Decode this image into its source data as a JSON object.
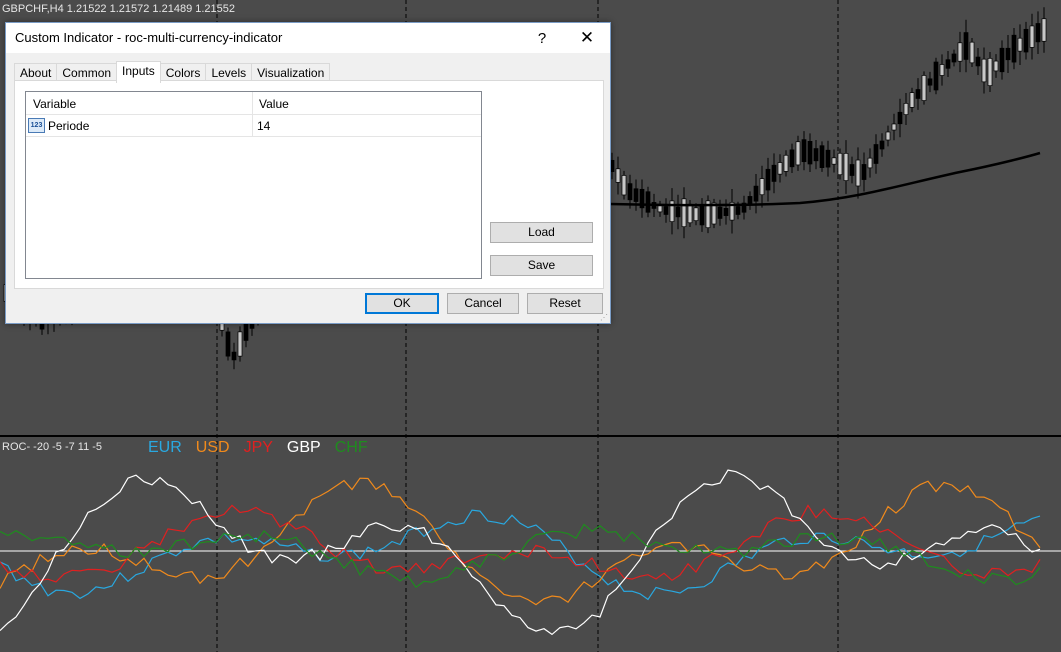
{
  "chart_header": {
    "symbol_line": "GBPCHF,H4  1.21522 1.21572 1.21489 1.21552",
    "indicator_line": "ROC- -20 -5 -7 11 -5"
  },
  "legend": [
    {
      "label": "EUR",
      "color": "#29a8e0"
    },
    {
      "label": "USD",
      "color": "#f08a1c"
    },
    {
      "label": "JPY",
      "color": "#e02020"
    },
    {
      "label": "GBP",
      "color": "#ffffff"
    },
    {
      "label": "CHF",
      "color": "#1e8c1e"
    }
  ],
  "dialog": {
    "title": "Custom Indicator - roc-multi-currency-indicator",
    "help_glyph": "?",
    "close_glyph": "✕",
    "tabs": [
      {
        "label": "About",
        "active": false
      },
      {
        "label": "Common",
        "active": false
      },
      {
        "label": "Inputs",
        "active": true
      },
      {
        "label": "Colors",
        "active": false
      },
      {
        "label": "Levels",
        "active": false
      },
      {
        "label": "Visualization",
        "active": false
      }
    ],
    "grid": {
      "col_variable": "Variable",
      "col_value": "Value",
      "rows": [
        {
          "icon_text": "123",
          "icon": "numeric-param-icon",
          "variable": "Periode",
          "value": "14"
        }
      ]
    },
    "buttons": {
      "load": "Load",
      "save": "Save",
      "ok": "OK",
      "cancel": "Cancel",
      "reset": "Reset"
    }
  },
  "colors": {
    "background": "#4b4b4b",
    "candle_up": "#c8c8c8",
    "candle_down": "#000000",
    "moving_average": "#000000",
    "separator": "#000000",
    "zero_line": "#ffffff"
  }
}
